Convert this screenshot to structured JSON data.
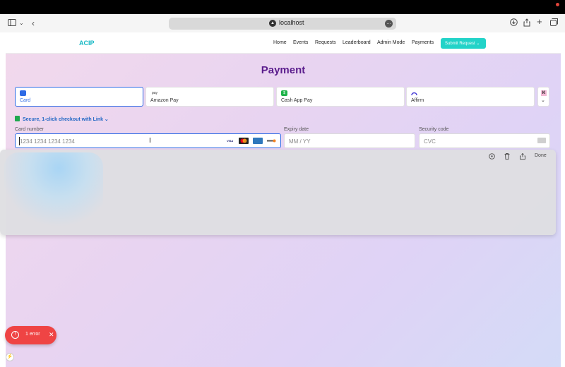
{
  "browser": {
    "url": "localhost",
    "icons": [
      "sidebar-icon",
      "chevron-down-icon",
      "back-icon",
      "download-icon",
      "share-icon",
      "new-tab-icon",
      "tabs-overview-icon"
    ]
  },
  "nav": {
    "brand": "ACIP",
    "links": [
      "Home",
      "Events",
      "Requests",
      "Leaderboard",
      "Admin Mode",
      "Payments"
    ],
    "submit_label": "Submit Request"
  },
  "payment": {
    "title": "Payment",
    "tabs": [
      {
        "label": "Card",
        "icon": "card-icon"
      },
      {
        "label": "Amazon Pay",
        "icon": "amazon-pay-icon",
        "badge": "pay"
      },
      {
        "label": "Cash App Pay",
        "icon": "cash-app-icon",
        "badge": "$"
      },
      {
        "label": "Affirm",
        "icon": "affirm-icon"
      }
    ],
    "more_badge": "K",
    "secure_text": "Secure, 1-click checkout with Link",
    "card_number_label": "Card number",
    "card_number_placeholder": "1234 1234 1234 1234",
    "card_brands": [
      "VISA",
      "MC",
      "AMEX",
      "DISCOVER"
    ],
    "expiry_label": "Expiry date",
    "expiry_placeholder": "MM / YY",
    "cvc_label": "Security code",
    "cvc_placeholder": "CVC"
  },
  "overlay": {
    "done_label": "Done"
  },
  "error_toast": {
    "text": "1 error"
  },
  "colors": {
    "accent": "#2e6be6",
    "brand": "#14b8c4",
    "title": "#5a1c8c",
    "error": "#ef4444"
  }
}
